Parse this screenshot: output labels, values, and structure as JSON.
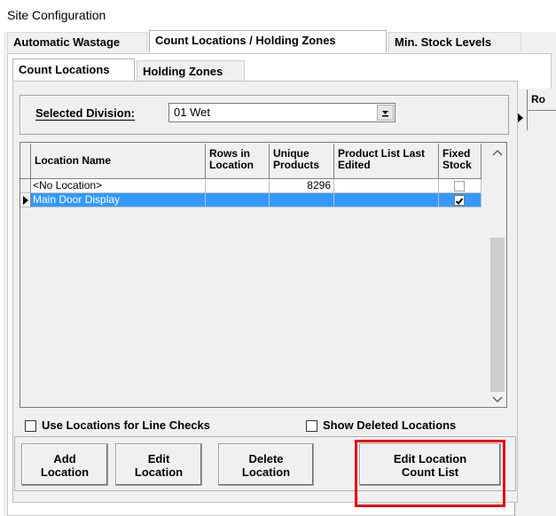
{
  "window": {
    "title": "Site Configuration"
  },
  "tabs": [
    {
      "label": "Automatic Wastage"
    },
    {
      "label": "Count Locations / Holding Zones"
    },
    {
      "label": "Min. Stock Levels"
    }
  ],
  "subtabs": [
    {
      "label": "Count Locations"
    },
    {
      "label": "Holding Zones"
    }
  ],
  "division": {
    "label": "Selected Division:",
    "value": "01 Wet"
  },
  "grid": {
    "columns": [
      {
        "label": "Location Name"
      },
      {
        "label": "Rows in Location"
      },
      {
        "label": "Unique Products"
      },
      {
        "label": "Product List Last Edited"
      },
      {
        "label": "Fixed Stock"
      }
    ],
    "rows": [
      {
        "name": "<No Location>",
        "rows_in_location": "",
        "unique_products": "8296",
        "last_edited": "",
        "fixed_stock": false,
        "selected": false
      },
      {
        "name": "Main Door Display",
        "rows_in_location": "",
        "unique_products": "",
        "last_edited": "",
        "fixed_stock": true,
        "selected": true
      }
    ]
  },
  "options": {
    "use_locations_label": "Use Locations for Line Checks",
    "show_deleted_label": "Show Deleted Locations"
  },
  "buttons": {
    "add": "Add Location",
    "edit": "Edit Location",
    "delete": "Delete Location",
    "edit_count_list": "Edit Location Count List"
  },
  "right_panel": {
    "header": "Ro"
  },
  "highlight_color": "#e8000b",
  "selection_color": "#3399ff"
}
